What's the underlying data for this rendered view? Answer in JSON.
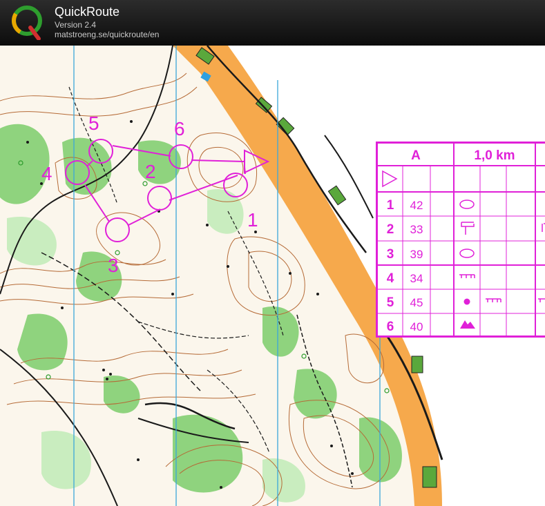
{
  "header": {
    "app_name": "QuickRoute",
    "version": "Version 2.4",
    "url": "matstroeng.se/quickroute/en",
    "logo_letter": "Q"
  },
  "map": {
    "controls": [
      {
        "number": "1"
      },
      {
        "number": "2"
      },
      {
        "number": "3"
      },
      {
        "number": "4"
      },
      {
        "number": "5"
      },
      {
        "number": "6"
      }
    ]
  },
  "description_sheet": {
    "course": "A",
    "length": "1,0 km",
    "rows": [
      {
        "number": "1",
        "code": "42",
        "symbol": "oval-icon"
      },
      {
        "number": "2",
        "code": "33",
        "symbol": "tee-icon"
      },
      {
        "number": "3",
        "code": "39",
        "symbol": "oval-icon"
      },
      {
        "number": "4",
        "code": "34",
        "symbol": "cliff-icon"
      },
      {
        "number": "5",
        "code": "45",
        "symbol": "dot-icon"
      },
      {
        "number": "6",
        "code": "40",
        "symbol": "mountain-icon"
      }
    ]
  },
  "colors": {
    "overprint": "#e020d8",
    "forest_green": "#8ad07a",
    "open_land": "#f7a84a",
    "contour": "#b0592b",
    "header_bg": "#1a1a1a"
  }
}
